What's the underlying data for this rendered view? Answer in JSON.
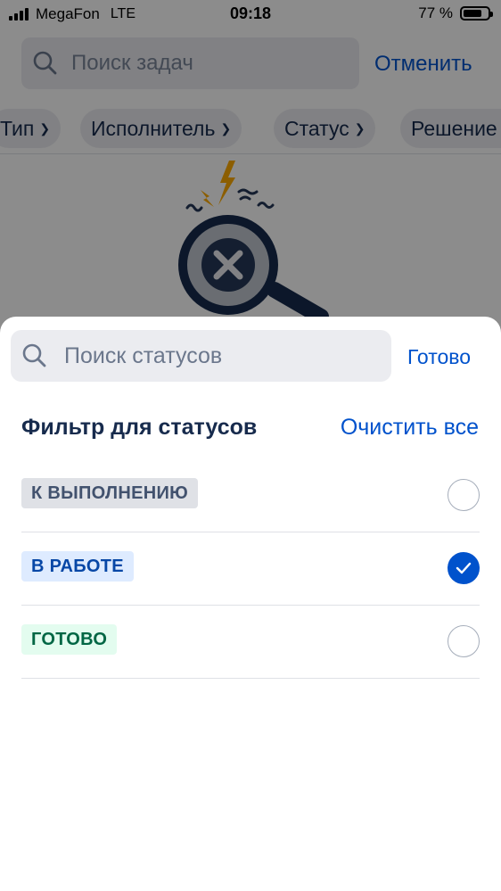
{
  "status_bar": {
    "carrier": "MegaFon",
    "network": "LTE",
    "time": "09:18",
    "battery": "77 %",
    "battery_level": 0.77
  },
  "search": {
    "placeholder": "Поиск задач",
    "cancel_label": "Отменить"
  },
  "filters": [
    {
      "label": "Тип"
    },
    {
      "label": "Исполнитель"
    },
    {
      "label": "Статус"
    },
    {
      "label": "Решение"
    }
  ],
  "sheet": {
    "search_placeholder": "Поиск статусов",
    "done_label": "Готово",
    "title": "Фильтр для статусов",
    "clear_all_label": "Очистить все",
    "statuses": [
      {
        "label": "К ВЫПОЛНЕНИЮ",
        "color": "#dfe1e6",
        "checked": false
      },
      {
        "label": "В РАБОТЕ",
        "color": "#deebff",
        "checked": true
      },
      {
        "label": "ГОТОВО",
        "color": "#e3fcef",
        "checked": false
      }
    ]
  },
  "colors": {
    "accent": "#0052cc",
    "text": "#172b4d",
    "warning_bolt": "#ffab00"
  }
}
